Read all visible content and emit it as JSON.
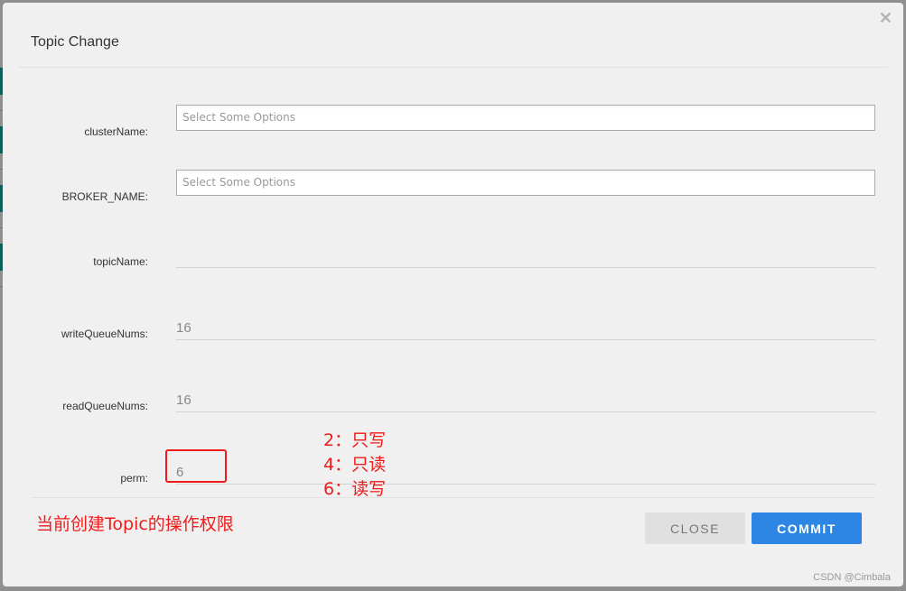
{
  "dialog": {
    "title": "Topic Change",
    "close_icon": "close-icon"
  },
  "form": {
    "fields": [
      {
        "label": "clusterName:",
        "type": "select",
        "placeholder": "Select Some Options",
        "value": ""
      },
      {
        "label": "BROKER_NAME:",
        "type": "select",
        "placeholder": "Select Some Options",
        "value": ""
      },
      {
        "label": "topicName:",
        "type": "text",
        "value": ""
      },
      {
        "label": "writeQueueNums:",
        "type": "text",
        "value": "16"
      },
      {
        "label": "readQueueNums:",
        "type": "text",
        "value": "16"
      },
      {
        "label": "perm:",
        "type": "text",
        "value": "6"
      }
    ]
  },
  "annotations": {
    "perm_legend": [
      "2：只写",
      "4：只读",
      "6：读写"
    ],
    "note": "当前创建Topic的操作权限",
    "color": "#f01a1a"
  },
  "footer": {
    "close_label": "CLOSE",
    "commit_label": "COMMIT"
  },
  "watermark": "CSDN @Cimbala",
  "colors": {
    "primary": "#2e86e4",
    "dialog_bg": "#f0f0f0",
    "overlay": "#8f8f8f"
  }
}
